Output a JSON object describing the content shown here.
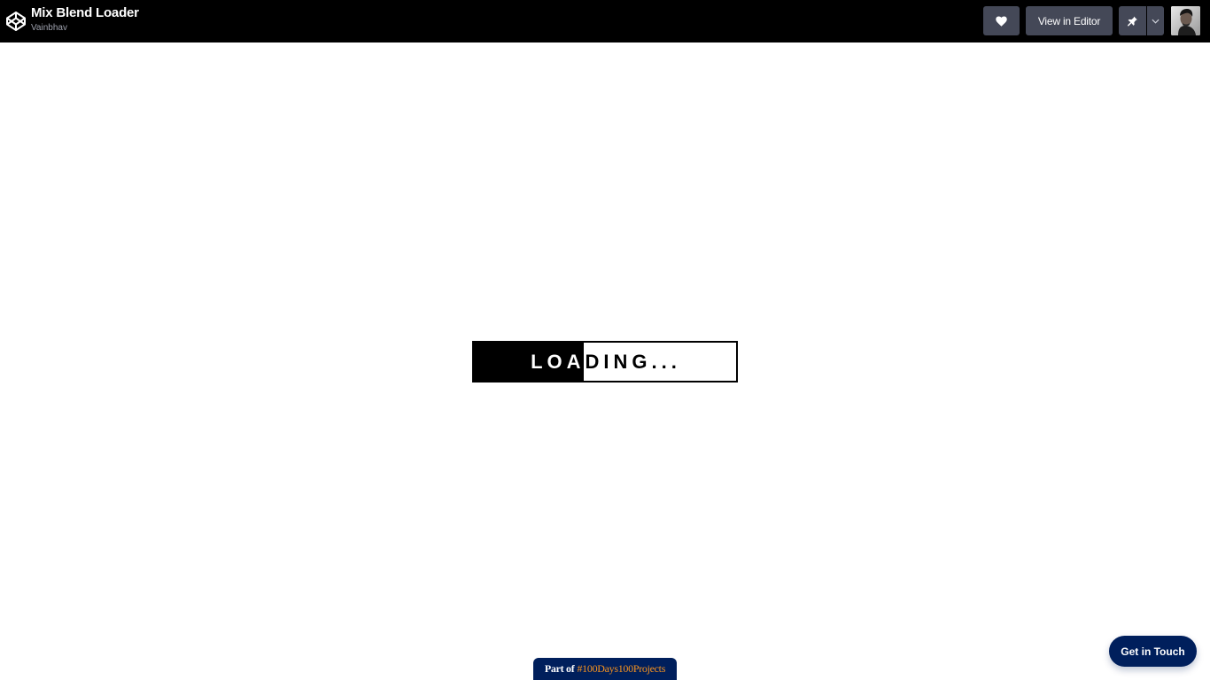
{
  "header": {
    "title": "Mix Blend Loader",
    "author": "Vainbhav",
    "view_editor_label": "View in Editor",
    "icons": {
      "logo": "codepen-logo-icon",
      "heart": "heart-icon",
      "pin": "pin-icon",
      "caret": "chevron-down-icon"
    }
  },
  "loader": {
    "text": "LOADING...",
    "progress": 0.42,
    "colors": {
      "fill": "#000000",
      "background": "#ffffff"
    }
  },
  "footer": {
    "badge_prefix": "Part of",
    "badge_tag": "#100Days100Projects",
    "contact_label": "Get in Touch"
  },
  "colors": {
    "topbar": "#000000",
    "button": "#444857",
    "navy": "#001f5c",
    "accent": "#f7931e"
  }
}
